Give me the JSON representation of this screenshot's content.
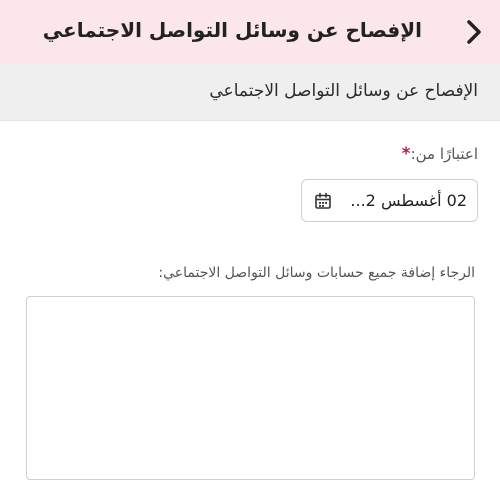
{
  "header": {
    "title": "الإفصاح عن وسائل التواصل الاجتماعي",
    "back_icon": "chevron-right-icon"
  },
  "section": {
    "title": "الإفصاح عن وسائل التواصل الاجتماعي"
  },
  "form": {
    "date_label": "اعتبارًا من:",
    "required_mark": "*",
    "date_value": "02 أغسطس 2...",
    "date_icon": "calendar-icon",
    "accounts_label": "الرجاء إضافة جميع حسابات وسائل التواصل الاجتماعي:",
    "accounts_value": ""
  },
  "colors": {
    "header_bg": "#fbe6ea",
    "subheader_bg": "#efefef",
    "required": "#c2185b"
  }
}
